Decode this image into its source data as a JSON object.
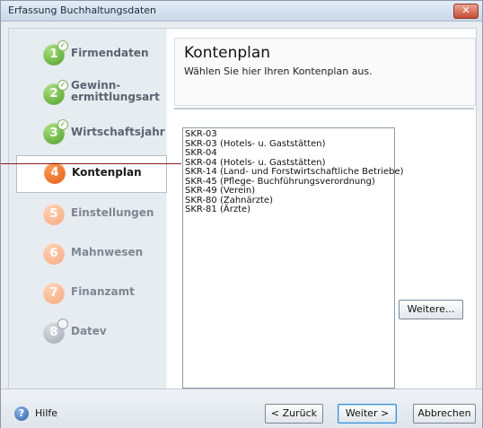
{
  "window": {
    "title": "Erfassung Buchhaltungsdaten",
    "close_glyph": "✕"
  },
  "steps": [
    {
      "num": "1",
      "label": "Firmendaten",
      "state": "done"
    },
    {
      "num": "2",
      "label": "Gewinn-\nermittlungsart",
      "state": "done"
    },
    {
      "num": "3",
      "label": "Wirtschaftsjahr",
      "state": "done"
    },
    {
      "num": "4",
      "label": "Kontenplan",
      "state": "active"
    },
    {
      "num": "5",
      "label": "Einstellungen",
      "state": "pending"
    },
    {
      "num": "6",
      "label": "Mahnwesen",
      "state": "pending"
    },
    {
      "num": "7",
      "label": "Finanzamt",
      "state": "pending"
    },
    {
      "num": "8",
      "label": "Datev",
      "state": "optional"
    }
  ],
  "header": {
    "title": "Kontenplan",
    "subtitle": "Wählen Sie hier Ihren Kontenplan aus."
  },
  "listbox": {
    "items": [
      "SKR-03",
      "SKR-03 (Hotels- u. Gaststätten)",
      "SKR-04",
      "SKR-04 (Hotels- u. Gaststätten)",
      "SKR-14 (Land- und Forstwirtschaftliche Betriebe)",
      "SKR-45 (Pflege- Buchführungsverordnung)",
      "SKR-49 (Verein)",
      "SKR-80 (Zahnärzte)",
      "SKR-81 (Ärzte)"
    ]
  },
  "buttons": {
    "more": "Weitere...",
    "back": "< Zurück",
    "next": "Weiter >",
    "cancel": "Abbrechen"
  },
  "footer": {
    "help": "Hilfe",
    "help_glyph": "?"
  },
  "colors": {
    "done": "#4a9d2a",
    "active": "#e05a10",
    "pending": "#f4a880",
    "optional": "#a0a8b2",
    "annotation": "#8b1a1a"
  }
}
